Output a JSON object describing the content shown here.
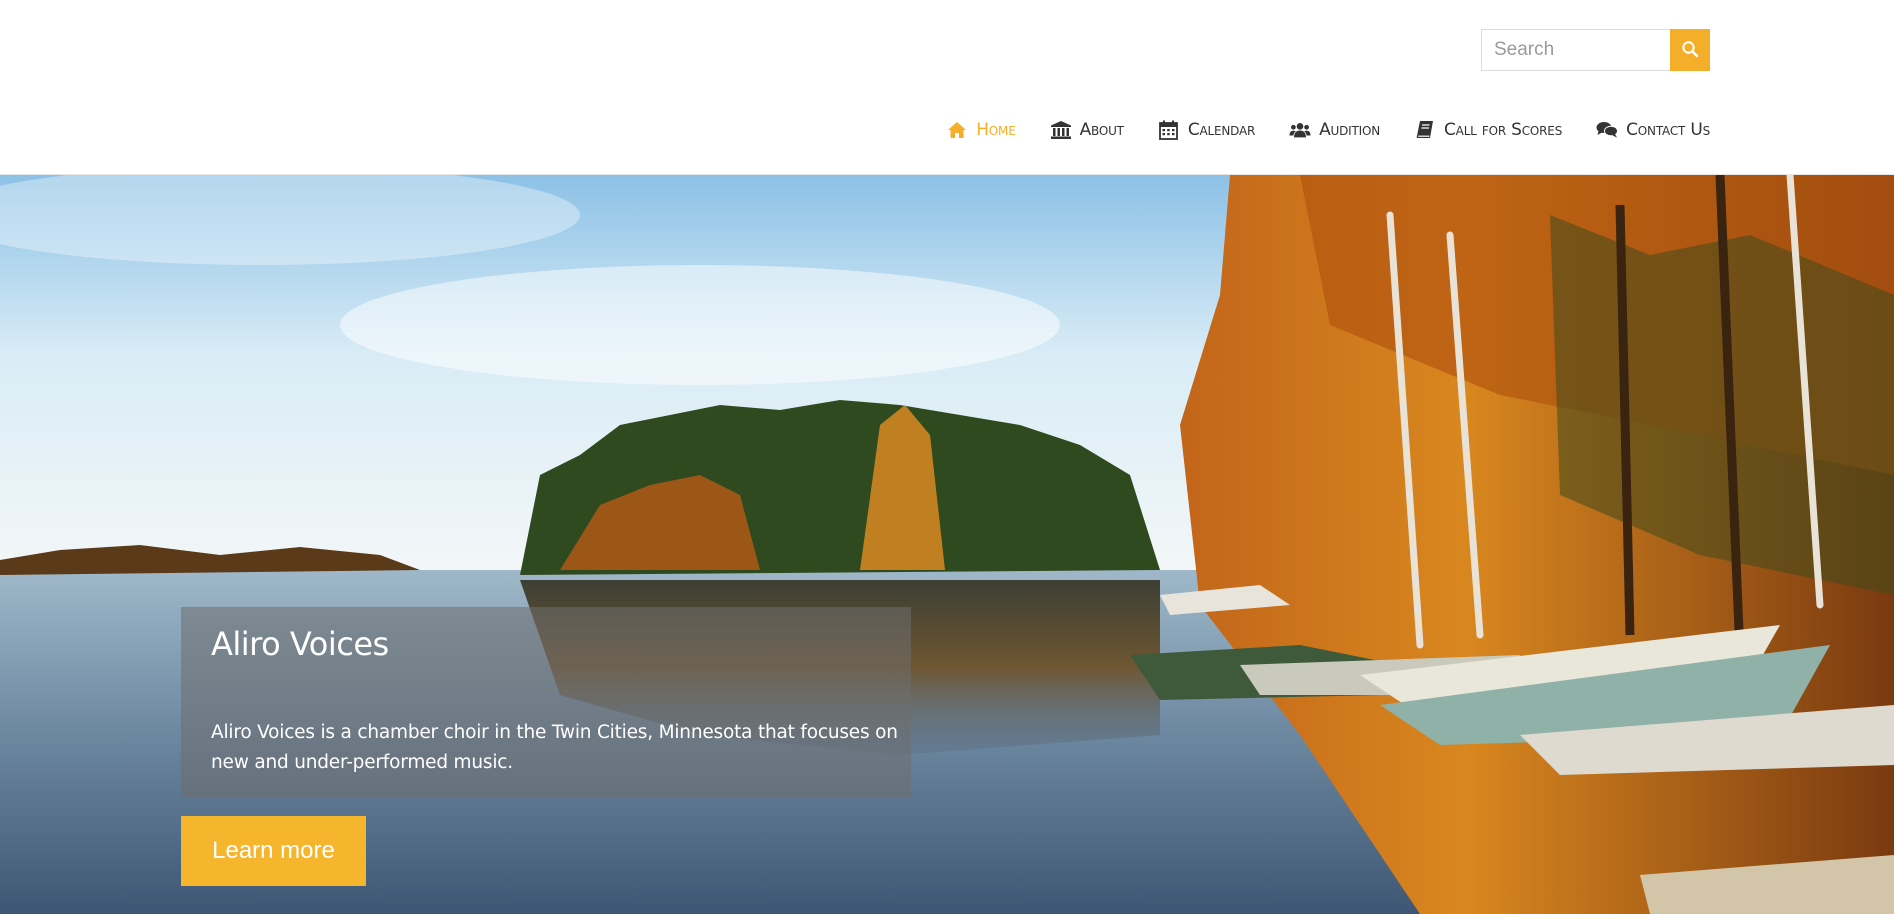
{
  "search": {
    "placeholder": "Search",
    "icon": "search-icon",
    "button_color": "#f5ae2a"
  },
  "nav": {
    "items": [
      {
        "label": "Home",
        "icon": "home-icon",
        "active": true
      },
      {
        "label": "About",
        "icon": "institution-icon",
        "active": false
      },
      {
        "label": "Calendar",
        "icon": "calendar-icon",
        "active": false
      },
      {
        "label": "Audition",
        "icon": "users-icon",
        "active": false
      },
      {
        "label": "Call for Scores",
        "icon": "book-icon",
        "active": false
      },
      {
        "label": "Contact Us",
        "icon": "comments-icon",
        "active": false
      }
    ],
    "active_color": "#f5ae2a",
    "text_color": "#333333"
  },
  "hero": {
    "title": "Aliro Voices",
    "description": "Aliro Voices is a chamber choir in the Twin Cities, Minnesota that focuses on new and under-performed music.",
    "cta_label": "Learn more",
    "cta_color": "#f5b62e"
  }
}
